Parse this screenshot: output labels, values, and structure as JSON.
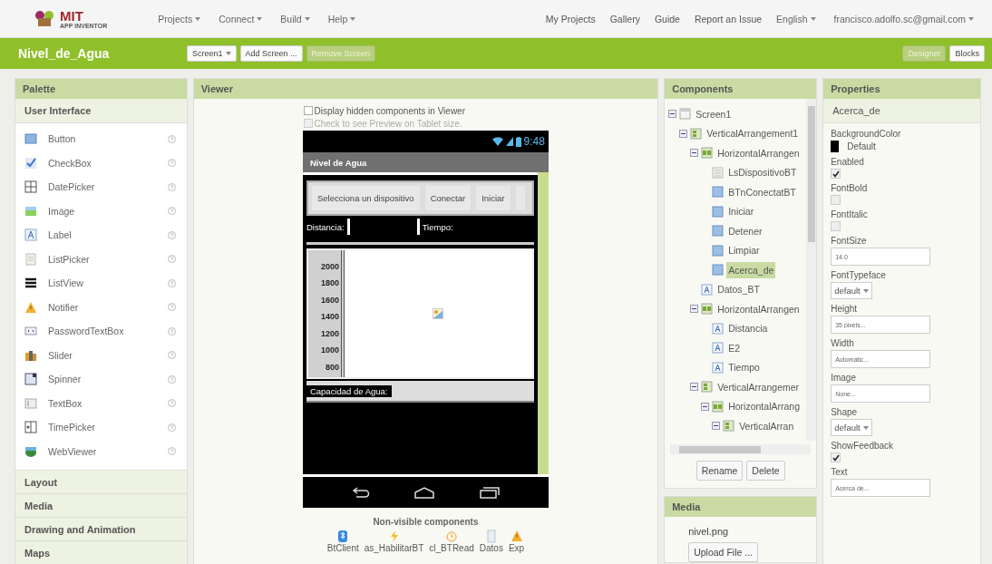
{
  "header": {
    "logo_title": "MIT",
    "logo_subtitle": "APP INVENTOR",
    "menus": [
      "Projects",
      "Connect",
      "Build",
      "Help"
    ],
    "links": [
      "My Projects",
      "Gallery",
      "Guide",
      "Report an Issue"
    ],
    "language": "English",
    "account": "francisco.adolfo.sc@gmail.com"
  },
  "project_bar": {
    "name": "Nivel_de_Agua",
    "screen": "Screen1",
    "buttons": [
      {
        "label": "Add Screen ...",
        "disabled": false
      },
      {
        "label": "Remove Screen",
        "disabled": true
      }
    ],
    "views": [
      {
        "label": "Designer",
        "selected": true
      },
      {
        "label": "Blocks",
        "selected": false
      }
    ]
  },
  "palette": {
    "title": "Palette",
    "open_section": "User Interface",
    "items": [
      "Button",
      "CheckBox",
      "DatePicker",
      "Image",
      "Label",
      "ListPicker",
      "ListView",
      "Notifier",
      "PasswordTextBox",
      "Slider",
      "Spinner",
      "TextBox",
      "TimePicker",
      "WebViewer"
    ],
    "sections": [
      "Layout",
      "Media",
      "Drawing and Animation",
      "Maps"
    ]
  },
  "viewer": {
    "title": "Viewer",
    "options": [
      {
        "label": "Display hidden components in Viewer",
        "checked": false,
        "disabled": false
      },
      {
        "label": "Check to see Preview on Tablet size.",
        "checked": false,
        "disabled": true
      }
    ],
    "phone": {
      "time": "9:48",
      "title": "Nivel de Agua",
      "buttons": [
        "Selecciona un dispositivo",
        "Conectar",
        "Iniciar"
      ],
      "labels": [
        "Distancia:",
        "Tiempo:"
      ],
      "axis_labels": [
        "2000",
        "1800",
        "1600",
        "1400",
        "1200",
        "1000",
        "800"
      ],
      "capacity_label": "Capacidad de Agua:"
    },
    "non_visible_title": "Non-visible components",
    "non_visible": [
      "BtClient",
      "as_HabilitarBT",
      "cl_BTRead",
      "Datos",
      "Exp"
    ]
  },
  "components": {
    "title": "Components",
    "tree": [
      {
        "label": "Screen1",
        "kind": "screen",
        "selected": false,
        "expanded": true,
        "children": [
          {
            "label": "VerticalArrangement1",
            "kind": "vertical",
            "selected": false,
            "expanded": true,
            "children": [
              {
                "label": "HorizontalArrangen",
                "kind": "horizontal",
                "selected": false,
                "expanded": true,
                "children": [
                  {
                    "label": "LsDispositivoBT",
                    "kind": "listpicker",
                    "selected": false
                  },
                  {
                    "label": "BTnConectatBT",
                    "kind": "button",
                    "selected": false
                  },
                  {
                    "label": "Iniciar",
                    "kind": "button",
                    "selected": false
                  },
                  {
                    "label": "Detener",
                    "kind": "button",
                    "selected": false
                  },
                  {
                    "label": "Limpiar",
                    "kind": "button",
                    "selected": false
                  },
                  {
                    "label": "Acerca_de",
                    "kind": "button",
                    "selected": true
                  }
                ]
              },
              {
                "label": "Datos_BT",
                "kind": "label",
                "selected": false
              },
              {
                "label": "HorizontalArrangen",
                "kind": "horizontal",
                "selected": false,
                "expanded": true,
                "children": [
                  {
                    "label": "Distancia",
                    "kind": "label",
                    "selected": false
                  },
                  {
                    "label": "E2",
                    "kind": "label",
                    "selected": false
                  },
                  {
                    "label": "Tiempo",
                    "kind": "label",
                    "selected": false
                  }
                ]
              },
              {
                "label": "VerticalArrangemer",
                "kind": "vertical",
                "selected": false,
                "expanded": true,
                "children": [
                  {
                    "label": "HorizontalArrang",
                    "kind": "horizontal",
                    "selected": false,
                    "expanded": true,
                    "children": [
                      {
                        "label": "VerticalArran",
                        "kind": "vertical",
                        "selected": false,
                        "expanded": true
                      }
                    ]
                  }
                ]
              }
            ]
          }
        ]
      }
    ],
    "buttons": [
      "Rename",
      "Delete"
    ]
  },
  "media": {
    "title": "Media",
    "files": [
      "nivel.png"
    ],
    "upload": "Upload File ..."
  },
  "properties": {
    "title": "Properties",
    "component": "Acerca_de",
    "items": [
      {
        "kind": "color",
        "label": "BackgroundColor",
        "value": "Default",
        "color": "#000000"
      },
      {
        "kind": "checkbox",
        "label": "Enabled",
        "checked": true
      },
      {
        "kind": "checkbox",
        "label": "FontBold",
        "checked": false
      },
      {
        "kind": "checkbox",
        "label": "FontItalic",
        "checked": false
      },
      {
        "kind": "text",
        "label": "FontSize",
        "value": "14.0"
      },
      {
        "kind": "dropdown",
        "label": "FontTypeface",
        "value": "default"
      },
      {
        "kind": "text",
        "label": "Height",
        "value": "35 pixels..."
      },
      {
        "kind": "text",
        "label": "Width",
        "value": "Automatic..."
      },
      {
        "kind": "text",
        "label": "Image",
        "value": "None..."
      },
      {
        "kind": "dropdown",
        "label": "Shape",
        "value": "default"
      },
      {
        "kind": "checkbox",
        "label": "ShowFeedback",
        "checked": true
      },
      {
        "kind": "text",
        "label": "Text",
        "value": "Acerca de..."
      }
    ]
  }
}
